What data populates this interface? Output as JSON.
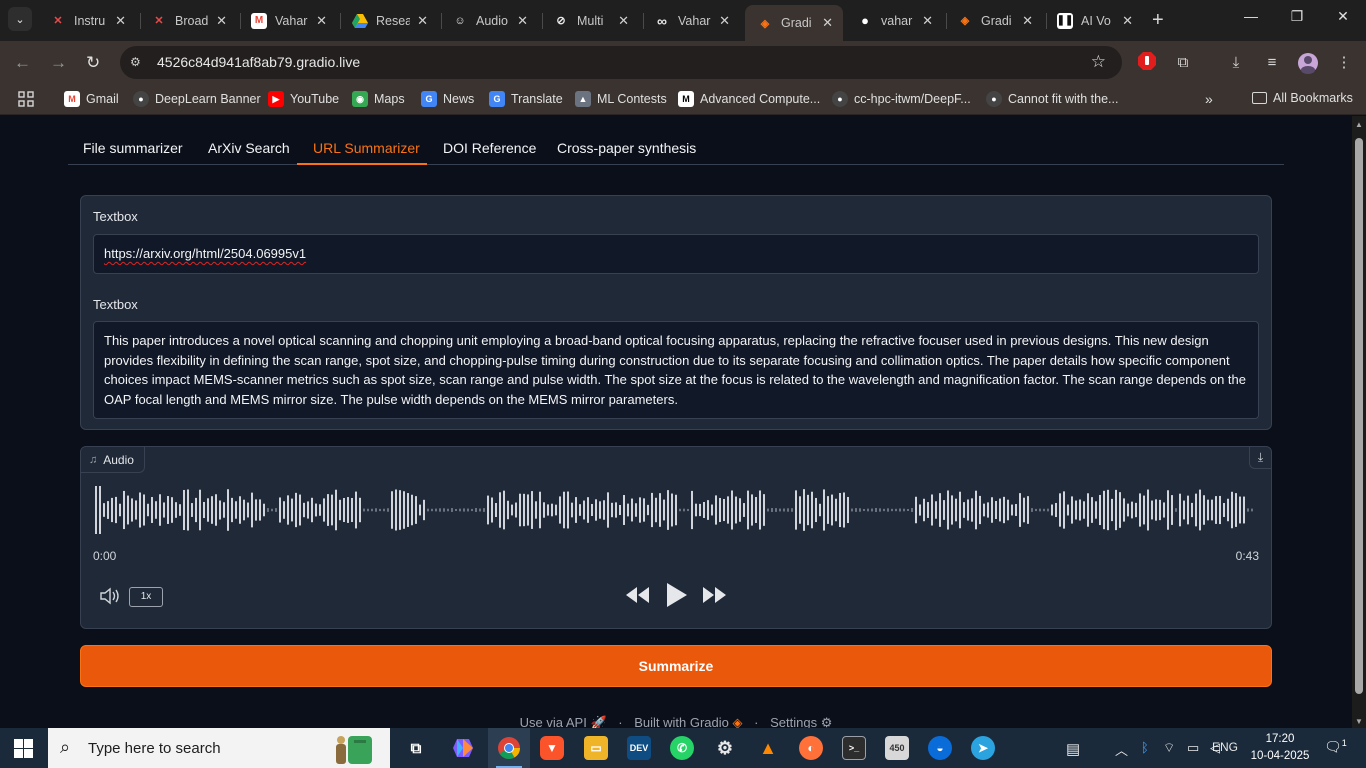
{
  "browser": {
    "tabs": [
      {
        "label": "Instru",
        "icon": "x-logo-icon"
      },
      {
        "label": "Broad",
        "icon": "x-logo-icon"
      },
      {
        "label": "Vahar",
        "icon": "gmail-icon"
      },
      {
        "label": "Resea",
        "icon": "drive-icon"
      },
      {
        "label": "Audio",
        "icon": "copilot-icon"
      },
      {
        "label": "Multi",
        "icon": "openai-icon"
      },
      {
        "label": "Vahar",
        "icon": "loop-icon"
      },
      {
        "label": "Gradi",
        "icon": "gradio-icon",
        "active": true
      },
      {
        "label": "vahar",
        "icon": "github-icon"
      },
      {
        "label": "Gradi",
        "icon": "gradio-icon"
      },
      {
        "label": "AI Vo",
        "icon": "notion-icon"
      }
    ],
    "url": "4526c84d941af8ab79.gradio.live",
    "bookmarks": [
      {
        "label": "Gmail",
        "icon": "gmail-icon"
      },
      {
        "label": "DeepLearn Banner",
        "icon": "github-icon"
      },
      {
        "label": "YouTube",
        "icon": "youtube-icon"
      },
      {
        "label": "Maps",
        "icon": "maps-icon"
      },
      {
        "label": "News",
        "icon": "news-icon"
      },
      {
        "label": "Translate",
        "icon": "translate-icon"
      },
      {
        "label": "ML Contests",
        "icon": "ml-icon"
      },
      {
        "label": "Advanced Compute...",
        "icon": "medium-icon"
      },
      {
        "label": "cc-hpc-itwm/DeepF...",
        "icon": "github-icon"
      },
      {
        "label": "Cannot fit with the...",
        "icon": "github-icon"
      }
    ],
    "all_bookmarks": "All Bookmarks"
  },
  "app": {
    "tabs": [
      "File summarizer",
      "ArXiv Search",
      "URL Summarizer",
      "DOI Reference",
      "Cross-paper synthesis"
    ],
    "selected_tab": "URL Summarizer",
    "input_label": "Textbox",
    "input_value": "https://arxiv.org/html/2504.06995v1",
    "output_label": "Textbox",
    "output_value": "This paper introduces a novel optical scanning and chopping unit employing a broad-band optical focusing apparatus, replacing the refractive focuser used in previous designs. This new design provides flexibility in defining the scan range, spot size, and chopping-pulse timing during construction due to its separate focusing and collimation optics. The paper details how specific component choices impact MEMS-scanner metrics such as spot size, scan range and pulse width. The spot size at the focus is related to the wavelength and magnification factor. The scan range depends on the OAP focal length and MEMS mirror size. The pulse width depends on the MEMS mirror parameters.",
    "audio": {
      "label": "Audio",
      "current_time": "0:00",
      "duration": "0:43",
      "playback_rate": "1x"
    },
    "submit_label": "Summarize",
    "footer": {
      "api": "Use via API",
      "built": "Built with Gradio",
      "settings": "Settings"
    }
  },
  "taskbar": {
    "search_placeholder": "Type here to search",
    "language": "ENG",
    "time": "17:20",
    "date": "10-04-2025",
    "notification_count": "1",
    "badge_450": "450"
  },
  "colors": {
    "accent": "#f97316",
    "button": "#ea580c",
    "panel": "#1f2937",
    "background": "#0b0f19"
  }
}
